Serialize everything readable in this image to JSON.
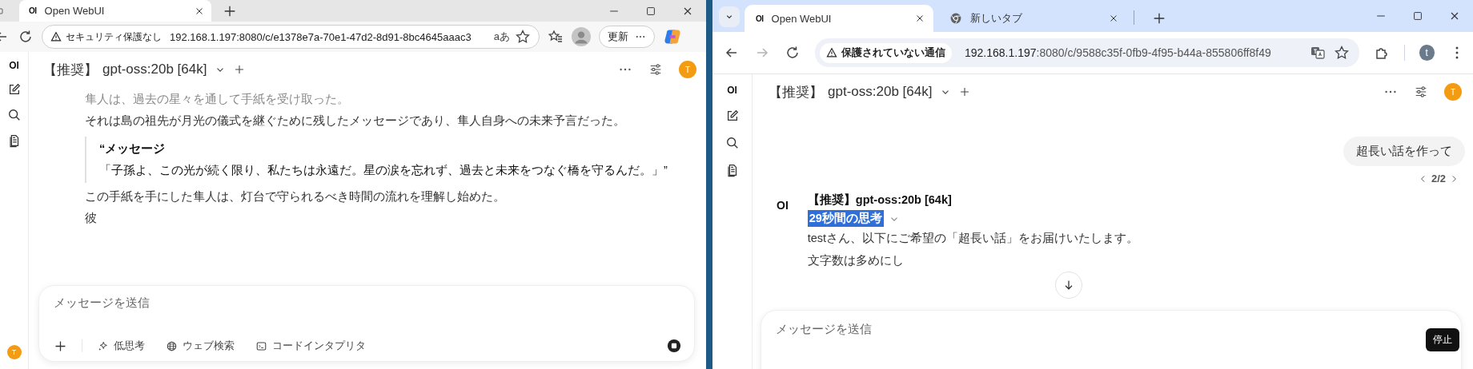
{
  "left_window": {
    "kind": "edge",
    "tabs": [
      {
        "label": "Open WebUI",
        "selected": true,
        "kind": "webui",
        "favicon_text": "OI"
      }
    ],
    "address": {
      "security": "セキュリティ保護なし",
      "url": "192.168.1.197:8080/c/e1378e7a-70e1-47d2-8d91-8bc4645aaac3",
      "read_aloud": "aあ"
    },
    "update_button": "更新",
    "app": {
      "logo": "OI",
      "model_prefix": "【推奨】",
      "model_name": "gpt-oss:20b [64k]",
      "avatar": "T",
      "sidebar_avatar": "T",
      "content": [
        {
          "kind": "paragraph",
          "text": "隼人は、過去の星々を通して手紙を受け取った。",
          "faded": true
        },
        {
          "kind": "paragraph",
          "text": "それは島の祖先が月光の儀式を継ぐために残したメッセージであり、隼人自身への未来予言だった。",
          "faded": false
        },
        {
          "kind": "quote",
          "title": "“メッセージ",
          "text": "「子孫よ、この光が続く限り、私たちは永遠だ。星の涙を忘れず、過去と未来をつなぐ橋を守るんだ。」”"
        },
        {
          "kind": "paragraph",
          "text": "この手紙を手にした隼人は、灯台で守られるべき時間の流れを理解し始めた。",
          "faded": false
        },
        {
          "kind": "paragraph",
          "text": "彼",
          "faded": false
        }
      ],
      "input": {
        "placeholder": "メッセージを送信",
        "tools": [
          {
            "kind": "think",
            "label": "低思考"
          },
          {
            "kind": "web",
            "label": "ウェブ検索"
          },
          {
            "kind": "code",
            "label": "コードインタプリタ"
          }
        ]
      }
    }
  },
  "right_window": {
    "kind": "chrome",
    "tabs": [
      {
        "label": "Open WebUI",
        "selected": true,
        "kind": "webui",
        "favicon_text": "OI"
      },
      {
        "label": "新しいタブ",
        "selected": false,
        "kind": "newtab"
      }
    ],
    "address": {
      "security": "保護されていない通信",
      "url_host": "192.168.1.197",
      "url_rest": ":8080/c/9588c35f-0fb9-4f95-b44a-855806ff8f49"
    },
    "profile": "t",
    "app": {
      "logo": "OI",
      "model_prefix": "【推奨】",
      "model_name": "gpt-oss:20b [64k]",
      "avatar": "T",
      "user_message": "超長い話を作って",
      "pager": "2/2",
      "assistant": {
        "logo": "OI",
        "name": "【推奨】gpt-oss:20b [64k]",
        "thinking": {
          "label": "29秒間の思考",
          "highlighted": true
        },
        "paragraphs": [
          "testさん、以下にご希望の「超長い話」をお届けいたします。",
          "文字数は多めにし"
        ]
      },
      "input": {
        "placeholder": "メッセージを送信"
      },
      "tooltip": "停止"
    }
  }
}
